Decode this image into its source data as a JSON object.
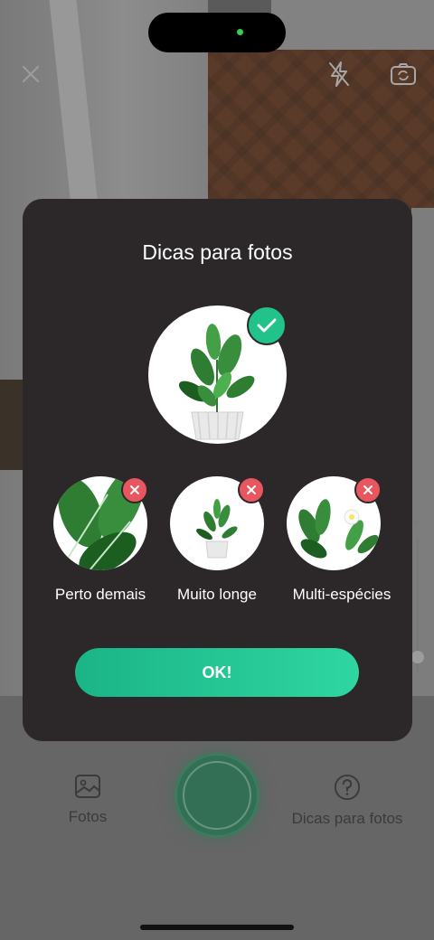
{
  "camera": {
    "close_icon": "close-icon",
    "flash_icon": "flash-off-icon",
    "switch_camera_icon": "camera-switch-icon",
    "slider_plus": "+"
  },
  "bottom_bar": {
    "photos_label": "Fotos",
    "photos_icon": "photo-gallery-icon",
    "tips_label": "Dicas para fotos",
    "tips_icon": "help-circle-icon"
  },
  "modal": {
    "title": "Dicas para fotos",
    "good_example_icon": "check-icon",
    "tips": [
      {
        "label": "Perto demais",
        "icon": "close-icon"
      },
      {
        "label": "Muito longe",
        "icon": "close-icon"
      },
      {
        "label": "Multi-espécies",
        "icon": "close-icon"
      }
    ],
    "ok_label": "OK!"
  },
  "colors": {
    "accent": "#21c38a",
    "error": "#e8575f",
    "modal_bg": "#2c2729"
  }
}
